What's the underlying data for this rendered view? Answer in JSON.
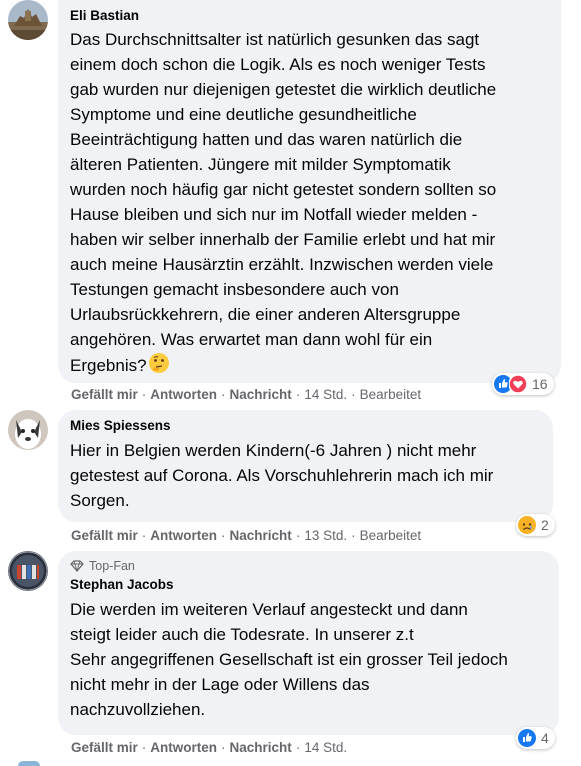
{
  "colors": {
    "bubble_bg": "#f0f2f5",
    "meta_text": "#65676b",
    "like_blue": "#1877f2",
    "love_red": "#f33e58",
    "sad_yellow": "#f7b125"
  },
  "comments": [
    {
      "author": "Eli Bastian",
      "text": "Das Durchschnittsalter ist natürlich gesunken das sagt\neinem doch schon die Logik. Als es noch weniger Tests\ngab wurden nur diejenigen getestet die wirklich deutliche\nSymptome und eine deutliche gesundheitliche\nBeeinträchtigung hatten und das waren natürlich die\nälteren Patienten. Jüngere mit milder Symptomatik\nwurden noch häufig gar nicht getestet sondern sollten so\nHause bleiben und sich nur im Notfall wieder melden -\nhaben wir selber innerhalb der Familie erlebt und hat mir\nauch meine Hausärztin erzählt. Inzwischen werden viele\nTestungen gemacht insbesondere auch von\nUrlaubsrückkehrern, die einer anderen Altersgruppe\nangehören. Was erwartet man dann wohl für ein\nErgebnis?",
      "emoji": "thinking-face-icon",
      "actions": {
        "like": "Gefällt mir",
        "reply": "Antworten",
        "message": "Nachricht",
        "time": "14 Std.",
        "edited": "Bearbeitet"
      },
      "reactions": {
        "icons": [
          "like-icon",
          "love-icon"
        ],
        "count": "16"
      }
    },
    {
      "author": "Mies Spiessens",
      "text": "Hier in Belgien werden Kindern(-6 Jahren ) nicht mehr\ngetestest auf Corona. Als Vorschuhlehrerin mach ich mir\nSorgen.",
      "actions": {
        "like": "Gefällt mir",
        "reply": "Antworten",
        "message": "Nachricht",
        "time": "13 Std.",
        "edited": "Bearbeitet"
      },
      "reactions": {
        "icons": [
          "sad-icon"
        ],
        "count": "2"
      }
    },
    {
      "badge": "Top-Fan",
      "badge_icon": "diamond-icon",
      "author": "Stephan Jacobs",
      "text": "Die werden im weiteren Verlauf angesteckt und dann\nsteigt leider auch die Todesrate. In unserer z.t\nSehr angegriffenen Gesellschaft ist ein grosser Teil jedoch\nnicht mehr in der Lage oder Willens das\nnachzuvollziehen.",
      "actions": {
        "like": "Gefällt mir",
        "reply": "Antworten",
        "message": "Nachricht",
        "time": "14 Std."
      },
      "reactions": {
        "icons": [
          "like-icon"
        ],
        "count": "4"
      }
    }
  ]
}
